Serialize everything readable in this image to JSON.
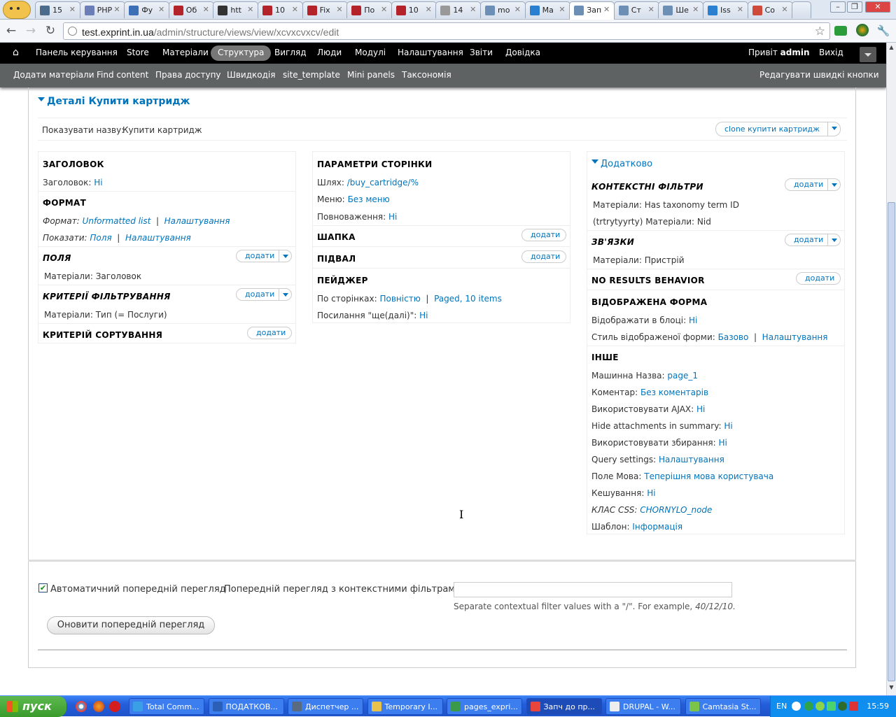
{
  "browser": {
    "tabs": [
      {
        "title": "15",
        "color": "#4a6b8a"
      },
      {
        "title": "PHP",
        "color": "#6c7eb7"
      },
      {
        "title": "Фу",
        "color": "#3b6fb6"
      },
      {
        "title": "Об",
        "color": "#b5232a"
      },
      {
        "title": "htt",
        "color": "#333333"
      },
      {
        "title": "10",
        "color": "#b5232a"
      },
      {
        "title": "Fix",
        "color": "#b5232a"
      },
      {
        "title": "По",
        "color": "#b5232a"
      },
      {
        "title": "10",
        "color": "#b5232a"
      },
      {
        "title": "14",
        "color": "#999999"
      },
      {
        "title": "mo",
        "color": "#6b8fb5"
      },
      {
        "title": "Ма",
        "color": "#2a7fd1"
      },
      {
        "title": "Зап",
        "color": "#6b8fb5",
        "active": true
      },
      {
        "title": "Ст",
        "color": "#6b8fb5"
      },
      {
        "title": "Ше",
        "color": "#6b8fb5"
      },
      {
        "title": "Iss",
        "color": "#2a7fd1"
      },
      {
        "title": "Со",
        "color": "#d04a3a"
      }
    ],
    "url_host": "test.exprint.in.ua",
    "url_path": "/admin/structure/views/view/xcvxcvxcv/edit"
  },
  "toolbar": {
    "items": [
      "Панель керування",
      "Store",
      "Матеріали",
      "Структура",
      "Вигляд",
      "Люди",
      "Модулі",
      "Налаштування",
      "Звіти",
      "Довідка"
    ],
    "greeting": "Привіт",
    "user": "admin",
    "logout": "Вихід",
    "shortcuts": [
      "Додати матеріали",
      "Find content",
      "Права доступу",
      "Швидкодія",
      "site_template",
      "Mini panels",
      "Таксономія"
    ],
    "edit_shortcuts": "Редагувати швидкі кнопки"
  },
  "view": {
    "details_title": "Деталі Купити картридж",
    "display_name_label": "Показувати назву:",
    "display_name_value": "Купити картридж",
    "clone_button": "clone купити картридж",
    "add": "додати",
    "col1": {
      "title_h": "ЗАГОЛОВОК",
      "title_label": "Заголовок:",
      "title_value": "Ні",
      "format_h": "ФОРМАТ",
      "format_label": "Формат:",
      "format_value": "Unformatted list",
      "format_settings": "Налаштування",
      "show_label": "Показати:",
      "show_value": "Поля",
      "show_settings": "Налаштування",
      "fields_h": "ПОЛЯ",
      "field_1": "Матеріали: Заголовок",
      "filter_h": "КРИТЕРІЇ ФІЛЬТРУВАННЯ",
      "filter_1": "Матеріали: Тип (= Послуги)",
      "sort_h": "КРИТЕРІЙ СОРТУВАННЯ"
    },
    "col2": {
      "page_h": "ПАРАМЕТРИ СТОРІНКИ",
      "path_label": "Шлях:",
      "path_value": "/buy_cartridge/%",
      "menu_label": "Меню:",
      "menu_value": "Без меню",
      "notify_label": "Повноваження:",
      "notify_value": "Ні",
      "header_h": "ШАПКА",
      "footer_h": "ПІДВАЛ",
      "pager_h": "ПЕЙДЖЕР",
      "pager_label": "По сторінках:",
      "pager_value_1": "Повністю",
      "pager_value_2": "Paged, 10 items",
      "more_label": "Посилання \"ще(далі)\":",
      "more_value": "Ні"
    },
    "col3": {
      "advanced": "Додатково",
      "ctx_h": "КОНТЕКСТНІ ФІЛЬТРИ",
      "ctx_1": "Матеріали: Has taxonomy term ID",
      "ctx_2": "(trtrytyyrty) Матеріали: Nid",
      "rel_h": "ЗВ'ЯЗКИ",
      "rel_1": "Матеріали: Пристрій",
      "noresults_h": "NO RESULTS BEHAVIOR",
      "exposed_h": "ВІДОБРАЖЕНА ФОРМА",
      "exposed_block_label": "Відображати в блоці:",
      "exposed_block_value": "Ні",
      "exposed_style_label": "Стиль відображеної форми:",
      "exposed_style_value": "Базово",
      "exposed_style_settings": "Налаштування",
      "other_h": "ІНШЕ",
      "rows": [
        {
          "label": "Машинна Назва:",
          "value": "page_1"
        },
        {
          "label": "Коментар:",
          "value": "Без коментарів"
        },
        {
          "label": "Використовувати AJAX:",
          "value": "Ні"
        },
        {
          "label": "Hide attachments in summary:",
          "value": "Ні"
        },
        {
          "label": "Використовувати збирання:",
          "value": "Ні"
        },
        {
          "label": "Query settings:",
          "value": "Налаштування"
        },
        {
          "label": "Поле Мова:",
          "value": "Теперішня мова користувача"
        },
        {
          "label": "Кешування:",
          "value": "Ні"
        },
        {
          "label": "КЛАС CSS:",
          "value": "CHORNYLO_node",
          "italic": true
        },
        {
          "label": "Шаблон:",
          "value": "Інформація"
        }
      ]
    }
  },
  "preview": {
    "auto_label": "Автоматичний попередній перегляд",
    "auto_checked": true,
    "ctx_label": "Попередній перегляд з контекстними фільтрами:",
    "ctx_input_value": "",
    "hint": "Separate contextual filter values with a \"/\". For example,",
    "hint_example": "40/12/10.",
    "update_button": "Оновити попередній перегляд"
  },
  "taskbar": {
    "start": "пуск",
    "tasks": [
      "Total Comm...",
      "ПОДАТКОВ...",
      "Диспетчер ...",
      "Temporary I...",
      "pages_expri...",
      "Запч до пр...",
      "DRUPAL - W...",
      "Camtasia St..."
    ],
    "lang": "EN",
    "clock": "15:59"
  }
}
